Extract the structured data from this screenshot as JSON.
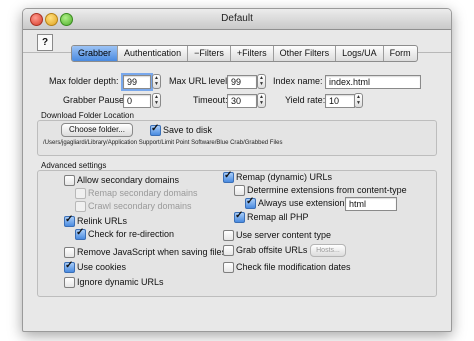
{
  "window": {
    "title": "Default"
  },
  "help_label": "?",
  "tabs": [
    "Grabber",
    "Authentication",
    "−Filters",
    "+Filters",
    "Other Filters",
    "Logs/UA",
    "Form"
  ],
  "fields": {
    "max_folder_depth": {
      "label": "Max folder depth:",
      "value": "99"
    },
    "max_url_level": {
      "label": "Max URL level:",
      "value": "99"
    },
    "index_name": {
      "label": "Index name:",
      "value": "index.html"
    },
    "grabber_pause": {
      "label": "Grabber Pause:",
      "value": "0"
    },
    "timeout": {
      "label": "Timeout:",
      "value": "30"
    },
    "yield_rate": {
      "label": "Yield rate:",
      "value": "10"
    }
  },
  "download_location": {
    "title": "Download Folder Location",
    "choose_button": "Choose folder...",
    "save_to_disk": "Save to disk",
    "path": "/Users/jgagliardi/Library/Application Support/Limit Point Software/Blue Crab/Grabbed Files"
  },
  "advanced": {
    "title": "Advanced settings",
    "allow_secondary": "Allow secondary domains",
    "remap_secondary": "Remap secondary domains",
    "crawl_secondary": "Crawl secondary domains",
    "relink_urls": "Relink URLs",
    "check_redirection": "Check for re-direction",
    "remove_js": "Remove JavaScript when saving files",
    "use_cookies": "Use cookies",
    "ignore_dynamic": "Ignore dynamic URLs",
    "remap_dynamic": "Remap (dynamic) URLs",
    "determine_ext": "Determine extensions from content-type",
    "always_use_ext": "Always use extension:",
    "extension_value": "html",
    "remap_php": "Remap all PHP",
    "use_server_content": "Use server content type",
    "grab_offsite": "Grab offsite URLs",
    "hosts_button": "Hosts...",
    "check_mod_dates": "Check file modification dates"
  }
}
